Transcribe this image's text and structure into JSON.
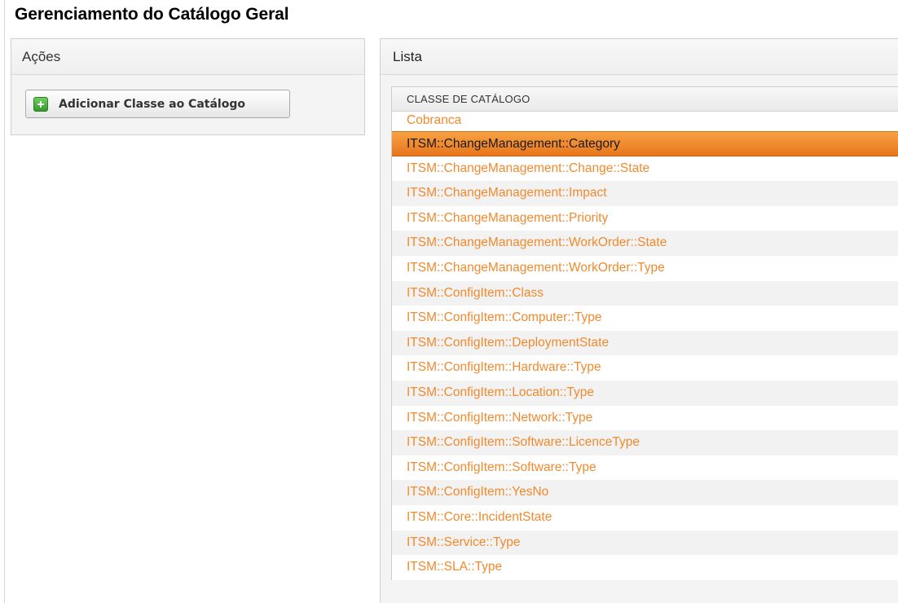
{
  "page": {
    "title": "Gerenciamento do Catálogo Geral"
  },
  "actions": {
    "header": "Ações",
    "add_button_label": "Adicionar Classe ao Catálogo",
    "add_button_icon": "plus-icon"
  },
  "list": {
    "header": "Lista",
    "column_header": "CLASSE DE CATÁLOGO",
    "selected_row": "ITSM::ChangeManagement::Category",
    "rows": [
      "Cobranca",
      "ITSM::ChangeManagement::Category",
      "ITSM::ChangeManagement::Change::State",
      "ITSM::ChangeManagement::Impact",
      "ITSM::ChangeManagement::Priority",
      "ITSM::ChangeManagement::WorkOrder::State",
      "ITSM::ChangeManagement::WorkOrder::Type",
      "ITSM::ConfigItem::Class",
      "ITSM::ConfigItem::Computer::Type",
      "ITSM::ConfigItem::DeploymentState",
      "ITSM::ConfigItem::Hardware::Type",
      "ITSM::ConfigItem::Location::Type",
      "ITSM::ConfigItem::Network::Type",
      "ITSM::ConfigItem::Software::LicenceType",
      "ITSM::ConfigItem::Software::Type",
      "ITSM::ConfigItem::YesNo",
      "ITSM::Core::IncidentState",
      "ITSM::Service::Type",
      "ITSM::SLA::Type"
    ]
  },
  "colors": {
    "link": "#f08a2e",
    "selected_bg": "#f39236",
    "plus_icon": "#3aa836"
  }
}
